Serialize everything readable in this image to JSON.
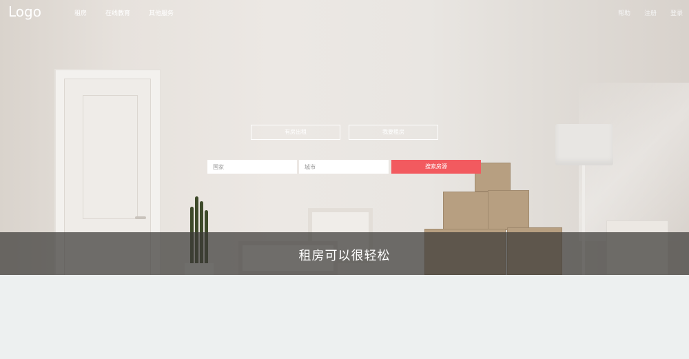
{
  "header": {
    "logo": "Logo",
    "nav": [
      {
        "label": "租房"
      },
      {
        "label": "在线教育"
      },
      {
        "label": "其他服务"
      }
    ],
    "right": [
      {
        "label": "帮助"
      },
      {
        "label": "注册"
      },
      {
        "label": "登录"
      }
    ]
  },
  "mode_buttons": {
    "rent_out": "有房出租",
    "rent_in": "我要租房"
  },
  "search": {
    "country_placeholder": "国家",
    "city_placeholder": "城市",
    "submit": "搜索房源"
  },
  "banner": {
    "tagline": "租房可以很轻松"
  },
  "colors": {
    "accent": "#f25a5f",
    "strip": "#3c3a38",
    "page_bg": "#edf0f0"
  }
}
